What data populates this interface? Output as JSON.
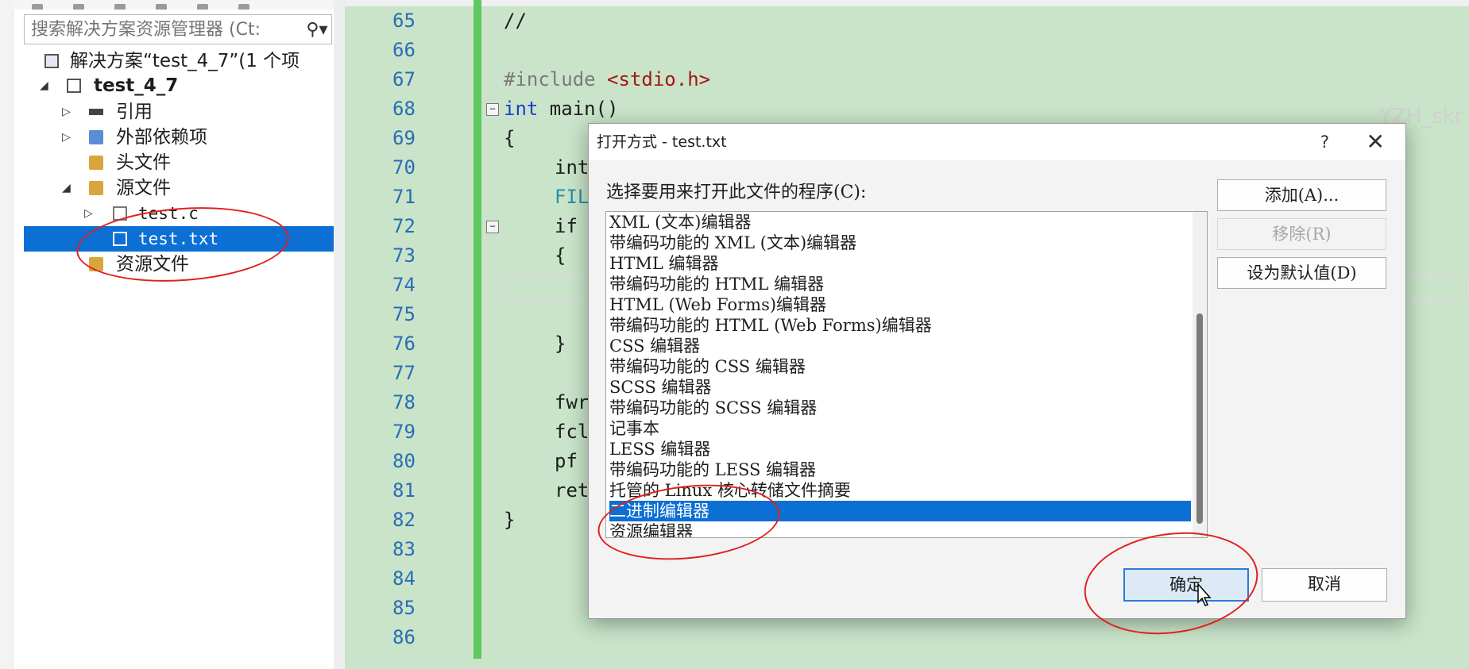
{
  "explorer": {
    "search_placeholder": "搜索解决方案资源管理器 (Ct:",
    "search_icon": "magnifier-icon",
    "items": [
      {
        "label": "解决方案“test_4_7”(1 个项",
        "icon": "solution-icon"
      },
      {
        "label": "test_4_7",
        "icon": "project-icon"
      },
      {
        "label": "引用",
        "icon": "references-icon"
      },
      {
        "label": "外部依赖项",
        "icon": "external-deps-icon"
      },
      {
        "label": "头文件",
        "icon": "folder-icon"
      },
      {
        "label": "源文件",
        "icon": "folder-icon"
      },
      {
        "label": "test.c",
        "icon": "c-file-icon"
      },
      {
        "label": "test.txt",
        "icon": "text-file-icon"
      },
      {
        "label": "资源文件",
        "icon": "folder-icon"
      }
    ]
  },
  "editor": {
    "lines": [
      {
        "num": "65",
        "code": "//"
      },
      {
        "num": "66",
        "code": ""
      },
      {
        "num": "67",
        "pp": "#include ",
        "str": "<stdio.h>"
      },
      {
        "num": "68",
        "kw": "int",
        "code": " main()"
      },
      {
        "num": "69",
        "code": "{"
      },
      {
        "num": "70",
        "kw": "int",
        "code": ""
      },
      {
        "num": "71",
        "code": "FIL"
      },
      {
        "num": "72",
        "kw": "if",
        "code": ""
      },
      {
        "num": "73",
        "code": "{"
      },
      {
        "num": "74",
        "code": ""
      },
      {
        "num": "75",
        "code": ""
      },
      {
        "num": "76",
        "code": "}"
      },
      {
        "num": "77",
        "code": ""
      },
      {
        "num": "78",
        "code": "fwr"
      },
      {
        "num": "79",
        "code": "fcl"
      },
      {
        "num": "80",
        "code": "pf"
      },
      {
        "num": "81",
        "kw": "ret",
        "code": ""
      },
      {
        "num": "82",
        "code": "}"
      },
      {
        "num": "83",
        "code": ""
      },
      {
        "num": "84",
        "code": ""
      },
      {
        "num": "85",
        "code": ""
      },
      {
        "num": "86",
        "code": ""
      }
    ],
    "watermark": "YZH_skr"
  },
  "dialog": {
    "title": "打开方式 - test.txt",
    "help": "?",
    "close": "✕",
    "prompt": "选择要用来打开此文件的程序(C):",
    "programs": [
      "XML (文本)编辑器",
      "带编码功能的 XML (文本)编辑器",
      "HTML 编辑器",
      "带编码功能的 HTML 编辑器",
      "HTML (Web Forms)编辑器",
      "带编码功能的 HTML (Web Forms)编辑器",
      "CSS 编辑器",
      "带编码功能的 CSS 编辑器",
      "SCSS 编辑器",
      "带编码功能的 SCSS 编辑器",
      "记事本",
      "LESS 编辑器",
      "带编码功能的 LESS 编辑器",
      "托管的 Linux 核心转储文件摘要",
      "二进制编辑器",
      "资源编辑器"
    ],
    "selected_program": "二进制编辑器",
    "buttons": {
      "add": "添加(A)...",
      "remove": "移除(R)",
      "set_default": "设为默认值(D)",
      "ok": "确定",
      "cancel": "取消"
    }
  },
  "colors": {
    "editor_bg": "#c9e4c9",
    "selection": "#0b6fd4",
    "line_number": "#2a6db5",
    "change_bar": "#5ec95e",
    "annotation": "#e02020"
  }
}
